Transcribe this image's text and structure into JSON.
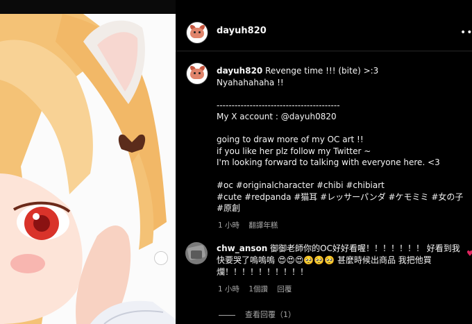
{
  "post": {
    "username": "dayuh820",
    "more_icon": "more-horizontal-icon"
  },
  "caption": {
    "username": "dayuh820",
    "lines": [
      "Revenge time !!! (bite) >:3",
      "Nyahahahaha !!",
      "",
      "-----------------------------------------",
      "My X account : @dayuh0820",
      "",
      "going to draw more of my OC art !!",
      "if you like her plz follow my Twitter ~",
      "I'm looking forward to talking with everyone here. <3",
      "",
      "#oc #originalcharacter #chibi #chibiart",
      "#cute #redpanda #猫耳 #レッサーパンダ #ケモミミ #女の子",
      "#原創"
    ],
    "time": "1 小時",
    "translate": "翻譯年糕"
  },
  "comment": {
    "username": "chw_anson",
    "text": "御御老師你的OC好好看喔！！！！！！！ 好看到我快要哭了嗚嗚嗚 😍😍😍🥺🥺🥺 甚麼時候出商品 我把他買爛！！！！！！！！！！",
    "time": "1 小時",
    "likes": "1個讚",
    "reply": "回覆",
    "view_replies": "查看回覆（1）"
  },
  "colors": {
    "background": "#000000",
    "text": "#f5f5f5",
    "secondary_text": "#a8a8a8",
    "like": "#e0245e"
  }
}
